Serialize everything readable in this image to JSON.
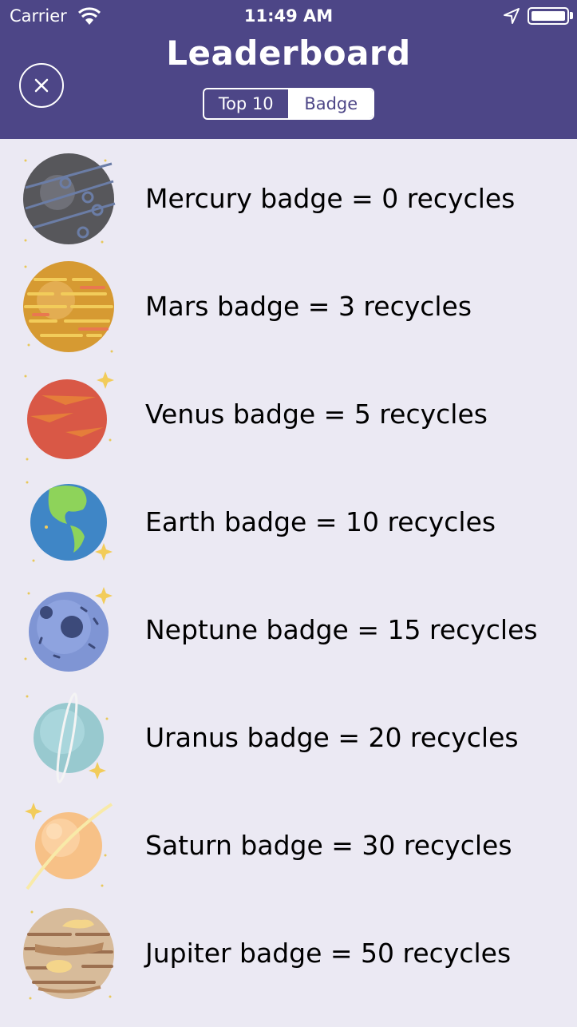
{
  "status_bar": {
    "carrier": "Carrier",
    "time": "11:49 AM"
  },
  "header": {
    "title": "Leaderboard",
    "close_icon": "close-icon",
    "segments": [
      "Top 10",
      "Badge"
    ],
    "selected_segment": "Badge",
    "background_color": "#4d4687"
  },
  "badges": [
    {
      "planet": "Mercury",
      "label": "Mercury badge = 0 recycles",
      "color": "#5a5a5e"
    },
    {
      "planet": "Mars",
      "label": "Mars badge = 3 recycles",
      "color": "#d69a32"
    },
    {
      "planet": "Venus",
      "label": "Venus badge = 5 recycles",
      "color": "#d95846"
    },
    {
      "planet": "Earth",
      "label": "Earth badge = 10 recycles",
      "color": "#3f86c6"
    },
    {
      "planet": "Neptune",
      "label": "Neptune badge = 15 recycles",
      "color": "#7f95d4"
    },
    {
      "planet": "Uranus",
      "label": "Uranus badge = 20 recycles",
      "color": "#98c9cf"
    },
    {
      "planet": "Saturn",
      "label": "Saturn badge = 30 recycles",
      "color": "#f7c187"
    },
    {
      "planet": "Jupiter",
      "label": "Jupiter badge = 50 recycles",
      "color": "#d7bb9a"
    }
  ]
}
